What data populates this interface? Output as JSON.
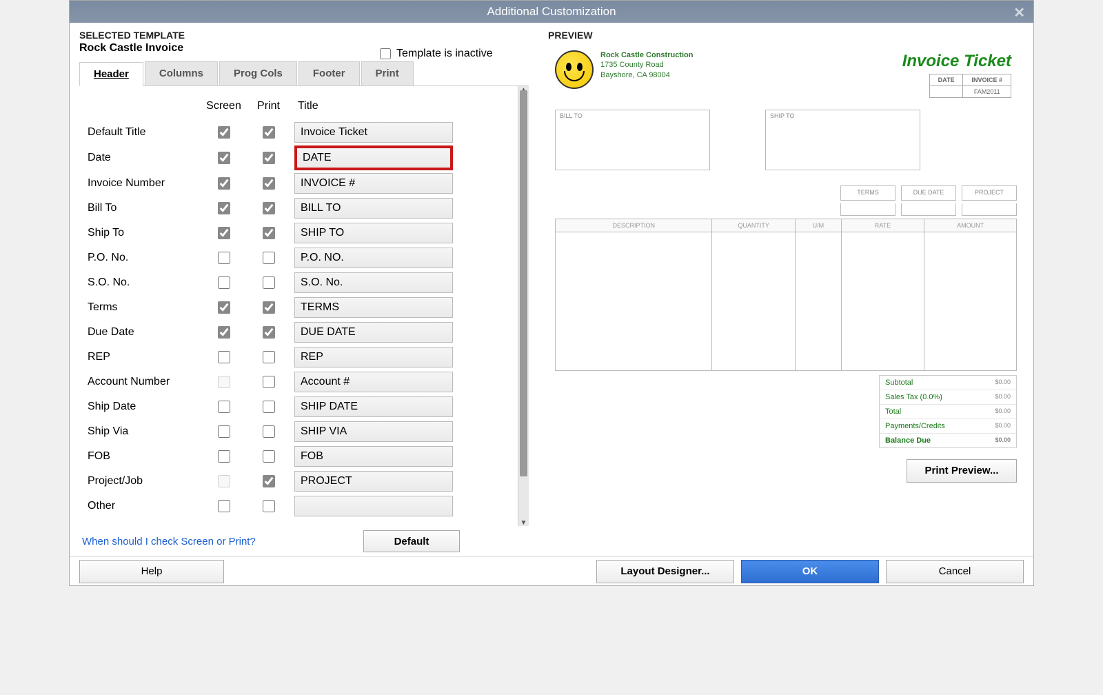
{
  "window": {
    "title": "Additional Customization"
  },
  "selected_template": {
    "label": "SELECTED TEMPLATE",
    "name": "Rock Castle Invoice"
  },
  "inactive": {
    "label": "Template is inactive",
    "checked": false
  },
  "tabs": [
    {
      "label": "Header",
      "active": true
    },
    {
      "label": "Columns",
      "active": false
    },
    {
      "label": "Prog Cols",
      "active": false
    },
    {
      "label": "Footer",
      "active": false
    },
    {
      "label": "Print",
      "active": false
    }
  ],
  "columns": {
    "screen": "Screen",
    "print": "Print",
    "title": "Title"
  },
  "fields": [
    {
      "label": "Default Title",
      "screen": true,
      "print": true,
      "title": "Invoice Ticket",
      "highlighted": false,
      "screen_enabled": true
    },
    {
      "label": "Date",
      "screen": true,
      "print": true,
      "title": "DATE",
      "highlighted": true,
      "screen_enabled": true
    },
    {
      "label": "Invoice Number",
      "screen": true,
      "print": true,
      "title": "INVOICE #",
      "highlighted": false,
      "screen_enabled": true
    },
    {
      "label": "Bill To",
      "screen": true,
      "print": true,
      "title": "BILL TO",
      "highlighted": false,
      "screen_enabled": true
    },
    {
      "label": "Ship To",
      "screen": true,
      "print": true,
      "title": "SHIP TO",
      "highlighted": false,
      "screen_enabled": true
    },
    {
      "label": "P.O. No.",
      "screen": false,
      "print": false,
      "title": "P.O. NO.",
      "highlighted": false,
      "screen_enabled": true
    },
    {
      "label": "S.O. No.",
      "screen": false,
      "print": false,
      "title": "S.O. No.",
      "highlighted": false,
      "screen_enabled": true
    },
    {
      "label": "Terms",
      "screen": true,
      "print": true,
      "title": "TERMS",
      "highlighted": false,
      "screen_enabled": true
    },
    {
      "label": "Due Date",
      "screen": true,
      "print": true,
      "title": "DUE DATE",
      "highlighted": false,
      "screen_enabled": true
    },
    {
      "label": "REP",
      "screen": false,
      "print": false,
      "title": "REP",
      "highlighted": false,
      "screen_enabled": true
    },
    {
      "label": "Account Number",
      "screen": false,
      "print": false,
      "title": "Account #",
      "highlighted": false,
      "screen_enabled": false
    },
    {
      "label": "Ship Date",
      "screen": false,
      "print": false,
      "title": "SHIP DATE",
      "highlighted": false,
      "screen_enabled": true
    },
    {
      "label": "Ship Via",
      "screen": false,
      "print": false,
      "title": "SHIP VIA",
      "highlighted": false,
      "screen_enabled": true
    },
    {
      "label": "FOB",
      "screen": false,
      "print": false,
      "title": "FOB",
      "highlighted": false,
      "screen_enabled": true
    },
    {
      "label": "Project/Job",
      "screen": false,
      "print": true,
      "title": "PROJECT",
      "highlighted": false,
      "screen_enabled": false
    },
    {
      "label": "Other",
      "screen": false,
      "print": false,
      "title": "",
      "highlighted": false,
      "screen_enabled": true
    }
  ],
  "helplink": "When should I check Screen or Print?",
  "buttons": {
    "default": "Default",
    "help": "Help",
    "layout": "Layout Designer...",
    "ok": "OK",
    "cancel": "Cancel",
    "print_preview": "Print Preview..."
  },
  "preview": {
    "label": "PREVIEW",
    "company": {
      "name": "Rock Castle Construction",
      "addr1": "1735 County Road",
      "addr2": "Bayshore, CA 98004"
    },
    "title": "Invoice Ticket",
    "date_label": "DATE",
    "invno_label": "INVOICE #",
    "invno_value": "FAM2011",
    "billto": "BILL TO",
    "shipto": "SHIP TO",
    "terms_labels": [
      "TERMS",
      "DUE DATE",
      "PROJECT"
    ],
    "line_headers": [
      "DESCRIPTION",
      "QUANTITY",
      "U/M",
      "RATE",
      "AMOUNT"
    ],
    "totals": [
      {
        "label": "Subtotal",
        "value": "$0.00"
      },
      {
        "label": "Sales Tax (0.0%)",
        "value": "$0.00"
      },
      {
        "label": "Total",
        "value": "$0.00"
      },
      {
        "label": "Payments/Credits",
        "value": "$0.00"
      },
      {
        "label": "Balance Due",
        "value": "$0.00"
      }
    ]
  }
}
